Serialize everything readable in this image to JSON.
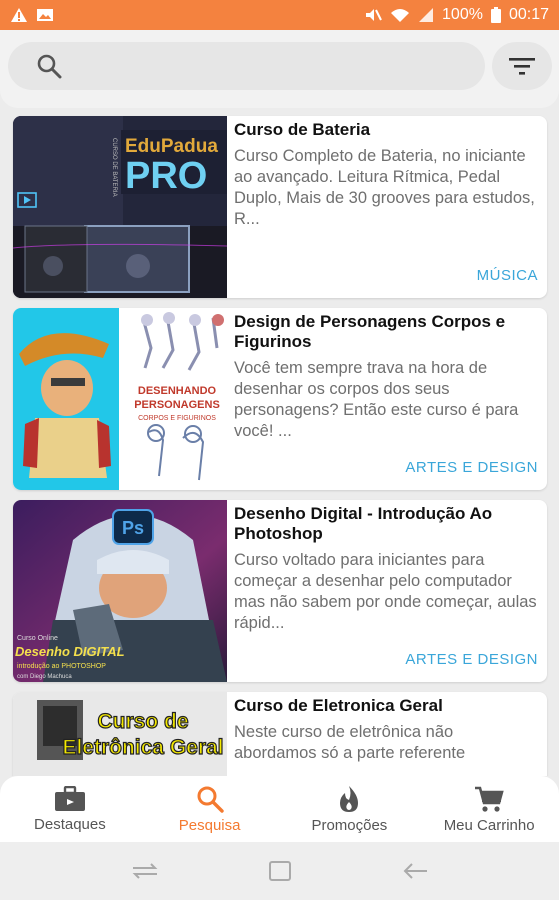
{
  "status_bar": {
    "battery_percent": "100%",
    "time": "00:17"
  },
  "search": {
    "placeholder": "",
    "value": ""
  },
  "courses": [
    {
      "title": "Curso de Bateria",
      "description": "Curso Completo de Bateria, no iniciante ao avançado. Leitura Rítmica, Pedal Duplo, Mais de 30 grooves para estudos, R...",
      "category": "MÚSICA",
      "thumb_text": [
        "EduPadua",
        "PRO",
        "CURSO DE BATERIA"
      ]
    },
    {
      "title": "Design de Personagens Corpos e Figurinos",
      "description": "Você tem sempre trava na hora de desenhar os corpos dos seus personagens? Então este curso é para você! ...",
      "category": "ARTES E DESIGN",
      "thumb_text": [
        "DESENHANDO",
        "PERSONAGENS",
        "CORPOS E FIGURINOS"
      ]
    },
    {
      "title": "Desenho Digital - Introdução Ao Photoshop",
      "description": "Curso voltado para iniciantes para começar a desenhar pelo computador mas não sabem por onde começar, aulas rápid...",
      "category": "ARTES E DESIGN",
      "thumb_text": [
        "Ps",
        "Curso Online",
        "Desenho DIGITAL",
        "introdução ao PHOTOSHOP",
        "com Diego Machuca"
      ]
    },
    {
      "title": "Curso de Eletronica Geral",
      "description": "Neste curso de eletrônica não abordamos só a parte referente",
      "category": "",
      "thumb_text": [
        "Curso de",
        "Eletrônica Geral"
      ]
    }
  ],
  "bottom_nav": {
    "items": [
      {
        "label": "Destaques",
        "icon": "briefcase-icon"
      },
      {
        "label": "Pesquisa",
        "icon": "search-icon",
        "active": true
      },
      {
        "label": "Promoções",
        "icon": "flame-icon"
      },
      {
        "label": "Meu Carrinho",
        "icon": "cart-icon"
      }
    ]
  },
  "colors": {
    "accent": "#f47a30",
    "status_bar": "#f4823f",
    "category": "#3aa6d9"
  }
}
